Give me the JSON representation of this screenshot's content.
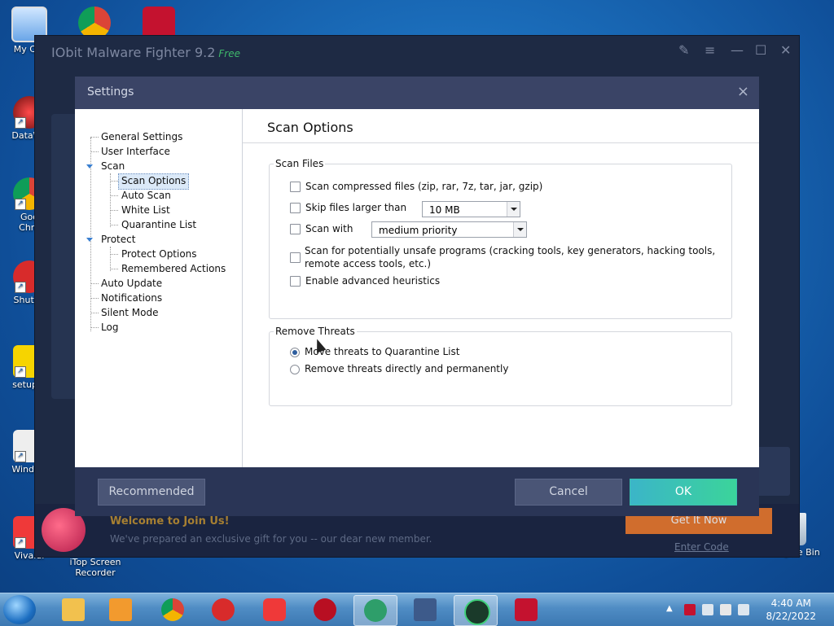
{
  "desktop": {
    "icons": [
      {
        "label": "My Cor"
      },
      {
        "label": "DataWa"
      },
      {
        "label": "Goo Chro"
      },
      {
        "label": "Shutdo"
      },
      {
        "label": "setupW"
      },
      {
        "label": "Window"
      },
      {
        "label": "Vivaldi"
      },
      {
        "label": "iTop Screen Recorder"
      },
      {
        "label": "Recycle Bin"
      }
    ]
  },
  "app": {
    "title": "IObit Malware Fighter 9.2",
    "edition": "Free",
    "promo": {
      "heading": "Welcome to Join Us!",
      "text": "We've prepared an exclusive gift for you -- our dear new member.",
      "button": "Get It Now",
      "link": "Enter Code"
    }
  },
  "dialog": {
    "title": "Settings",
    "close": "×",
    "tree": [
      {
        "label": "General Settings",
        "level": 0
      },
      {
        "label": "User Interface",
        "level": 0
      },
      {
        "label": "Scan",
        "level": 0,
        "expanded": true
      },
      {
        "label": "Scan Options",
        "level": 1,
        "selected": true
      },
      {
        "label": "Auto Scan",
        "level": 1
      },
      {
        "label": "White List",
        "level": 1
      },
      {
        "label": "Quarantine List",
        "level": 1
      },
      {
        "label": "Protect",
        "level": 0,
        "expanded": true
      },
      {
        "label": "Protect Options",
        "level": 1
      },
      {
        "label": "Remembered Actions",
        "level": 1
      },
      {
        "label": "Auto Update",
        "level": 0
      },
      {
        "label": "Notifications",
        "level": 0
      },
      {
        "label": "Silent Mode",
        "level": 0
      },
      {
        "label": "Log",
        "level": 0
      }
    ],
    "content": {
      "title": "Scan Options",
      "scan_files": {
        "label": "Scan Files",
        "compressed": {
          "label": "Scan compressed files (zip, rar, 7z, tar, jar, gzip)",
          "checked": false
        },
        "skip_larger": {
          "label": "Skip files larger than",
          "checked": false,
          "value": "10 MB"
        },
        "scan_with": {
          "label": "Scan with",
          "checked": false,
          "value": "medium priority"
        },
        "unsafe": {
          "label": "Scan for potentially unsafe programs (cracking tools, key generators, hacking tools, remote access tools, etc.)",
          "checked": false
        },
        "heuristics": {
          "label": "Enable advanced heuristics",
          "checked": false
        }
      },
      "remove_threats": {
        "label": "Remove Threats",
        "move": {
          "label": "Move threats to Quarantine List",
          "selected": true
        },
        "remove": {
          "label": "Remove threats directly and permanently",
          "selected": false
        }
      }
    },
    "buttons": {
      "recommended": "Recommended",
      "cancel": "Cancel",
      "ok": "OK"
    }
  },
  "taskbar": {
    "time": "4:40 AM",
    "date": "8/22/2022"
  }
}
